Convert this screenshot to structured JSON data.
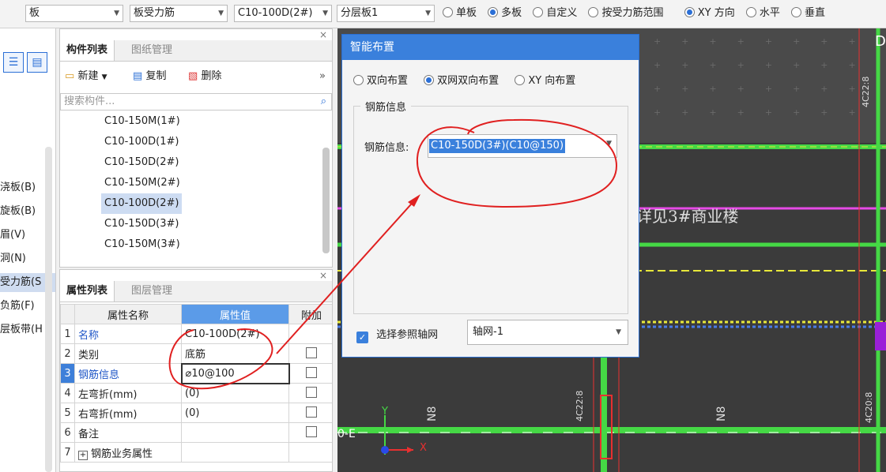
{
  "toolbar": {
    "combo1": "板",
    "combo2": "板受力筋",
    "combo3": "C10-100D(2#)",
    "combo4": "分层板1",
    "radios": [
      {
        "label": "单板",
        "checked": false
      },
      {
        "label": "多板",
        "checked": true
      },
      {
        "label": "自定义",
        "checked": false
      },
      {
        "label": "按受力筋范围",
        "checked": false
      },
      {
        "label": "XY 方向",
        "checked": true
      },
      {
        "label": "水平",
        "checked": false
      },
      {
        "label": "垂直",
        "checked": false
      }
    ]
  },
  "nav": {
    "items": [
      {
        "label": "浇板(B)",
        "selected": false
      },
      {
        "label": "旋板(B)",
        "selected": false
      },
      {
        "label": "眉(V)",
        "selected": false
      },
      {
        "label": "洞(N)",
        "selected": false
      },
      {
        "label": "受力筋(S",
        "selected": true
      },
      {
        "label": "负筋(F)",
        "selected": false
      },
      {
        "label": "层板带(H",
        "selected": false
      }
    ]
  },
  "components": {
    "tab_active": "构件列表",
    "tab_other": "图纸管理",
    "close": "×",
    "new_label": "新建",
    "copy_label": "复制",
    "delete_label": "删除",
    "more": "»",
    "search_placeholder": "搜索构件...",
    "items": [
      "C10-150M(1#)",
      "C10-100D(1#)",
      "C10-150D(2#)",
      "C10-150M(2#)",
      "C10-100D(2#)",
      "C10-150D(3#)",
      "C10-150M(3#)"
    ],
    "selected_index": 4
  },
  "properties": {
    "tab_active": "属性列表",
    "tab_other": "图层管理",
    "close": "×",
    "col_name": "属性名称",
    "col_value": "属性值",
    "col_extra": "附加",
    "rows": [
      {
        "num": "1",
        "name": "名称",
        "value": "C10-100D(2#)",
        "checkbox": false
      },
      {
        "num": "2",
        "name": "类别",
        "value": "底筋",
        "checkbox": true
      },
      {
        "num": "3",
        "name": "钢筋信息",
        "value": "⌀10@100",
        "checkbox": true
      },
      {
        "num": "4",
        "name": "左弯折(mm)",
        "value": "(0)",
        "checkbox": true
      },
      {
        "num": "5",
        "name": "右弯折(mm)",
        "value": "(0)",
        "checkbox": true
      },
      {
        "num": "6",
        "name": "备注",
        "value": "",
        "checkbox": true
      },
      {
        "num": "7",
        "name": "钢筋业务属性",
        "value": "",
        "checkbox": false
      }
    ]
  },
  "dialog": {
    "title": "智能布置",
    "radios": [
      {
        "label": "双向布置",
        "checked": false
      },
      {
        "label": "双网双向布置",
        "checked": true
      },
      {
        "label": "XY 向布置",
        "checked": false
      }
    ],
    "group_title": "钢筋信息",
    "rebar_label": "钢筋信息:",
    "rebar_value": "C10-150D(3#)(C10@150)",
    "ref_checkbox_label": "选择参照轴网",
    "axis_grid_value": "轴网-1"
  },
  "drawing": {
    "label_beam": "4C22:8",
    "label_building": "详见3#商业楼",
    "label_beam2": "4C22:8",
    "label_beam3": "4C20:8",
    "label_n8a": "N8",
    "label_n8b": "N8",
    "axis_label": "0-E",
    "y_axis": "Y",
    "x_axis": "X",
    "corner_text": "D"
  }
}
